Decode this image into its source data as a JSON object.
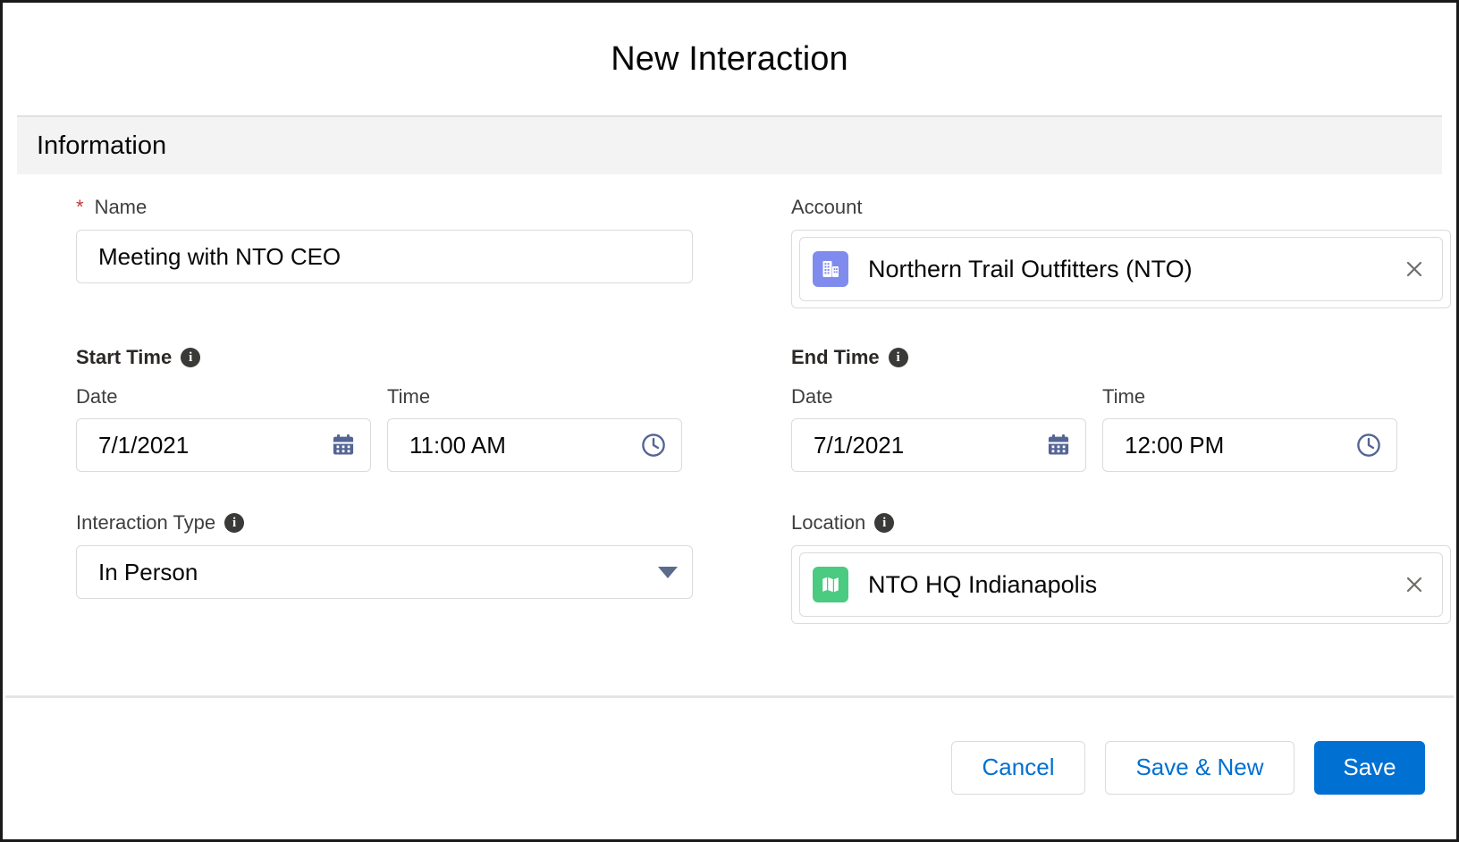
{
  "modal": {
    "title": "New Interaction",
    "section_title": "Information"
  },
  "fields": {
    "name": {
      "label": "Name",
      "required_marker": "*",
      "value": "Meeting with NTO CEO",
      "placeholder": ""
    },
    "account": {
      "label": "Account",
      "pill_text": "Northern Trail Outfitters (NTO)",
      "icon": "account-building-icon",
      "icon_color": "#7f8ced",
      "clear_icon": "close-icon"
    },
    "start_time": {
      "label": "Start Time",
      "info_icon": "info-icon",
      "date_label": "Date",
      "date_value": "7/1/2021",
      "date_icon": "calendar-icon",
      "time_label": "Time",
      "time_value": "11:00 AM",
      "time_icon": "clock-icon"
    },
    "end_time": {
      "label": "End Time",
      "info_icon": "info-icon",
      "date_label": "Date",
      "date_value": "7/1/2021",
      "date_icon": "calendar-icon",
      "time_label": "Time",
      "time_value": "12:00 PM",
      "time_icon": "clock-icon"
    },
    "interaction_type": {
      "label": "Interaction Type",
      "info_icon": "info-icon",
      "value": "In Person",
      "caret_icon": "chevron-down-icon"
    },
    "location": {
      "label": "Location",
      "info_icon": "info-icon",
      "pill_text": "NTO HQ Indianapolis",
      "icon": "map-location-icon",
      "icon_color": "#4bca81",
      "clear_icon": "close-icon"
    }
  },
  "footer": {
    "cancel_label": "Cancel",
    "save_new_label": "Save & New",
    "save_label": "Save"
  },
  "colors": {
    "brand_blue": "#0070d2",
    "link_blue": "#0070d2",
    "required_red": "#c23934",
    "section_band": "#f3f3f3",
    "field_icon_navy": "#546494",
    "account_purple": "#7f8ced",
    "location_green": "#4bca81"
  },
  "info_glyph": "i"
}
